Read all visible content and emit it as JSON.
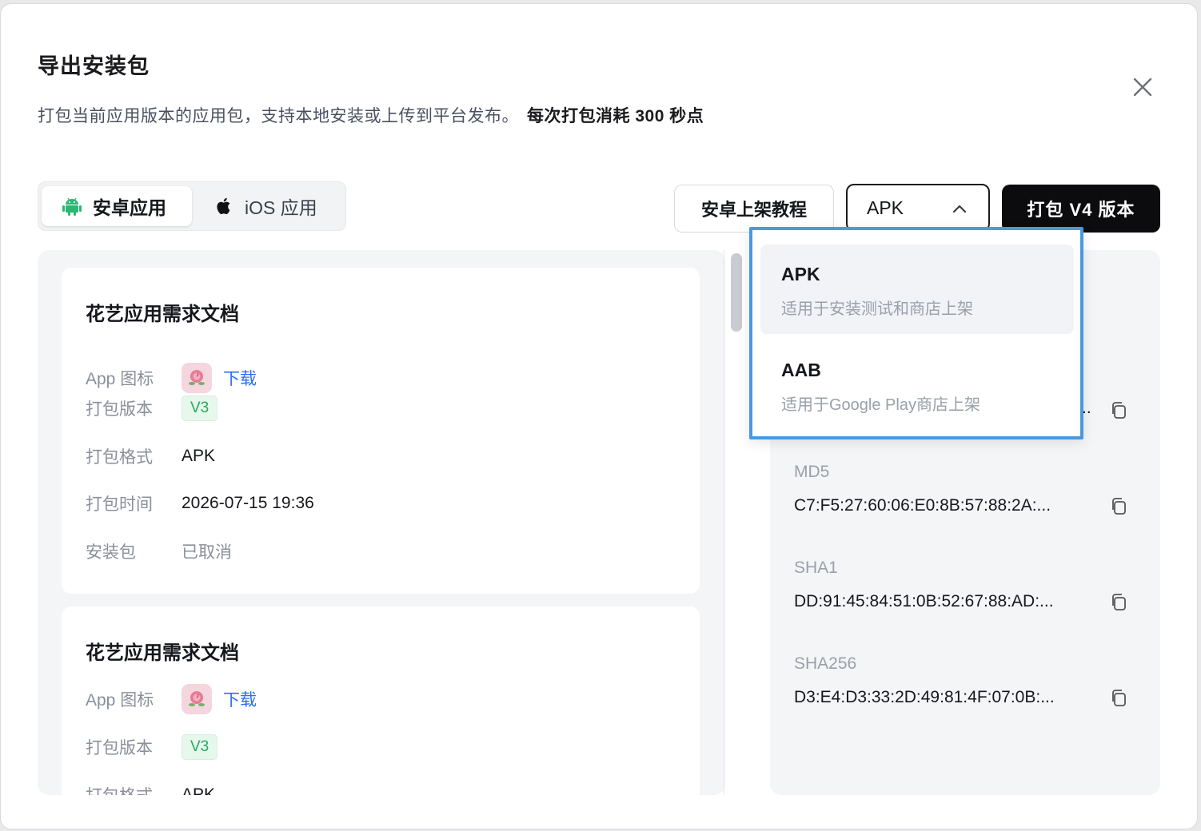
{
  "dialog": {
    "title": "导出安装包",
    "subtitle": "打包当前应用版本的应用包，支持本地安装或上传到平台发布。",
    "cost_note": "每次打包消耗 300 秒点"
  },
  "platform_tabs": [
    {
      "label": "安卓应用",
      "icon": "android-icon",
      "active": true
    },
    {
      "label": "iOS 应用",
      "icon": "apple-icon",
      "active": false
    }
  ],
  "toolbar": {
    "tutorial_label": "安卓上架教程",
    "format_selected": "APK",
    "build_label": "打包 V4 版本"
  },
  "format_options": [
    {
      "title": "APK",
      "desc": "适用于安装测试和商店上架"
    },
    {
      "title": "AAB",
      "desc": "适用于Google Play商店上架"
    }
  ],
  "builds": [
    {
      "title": "花艺应用需求文档",
      "icon_label": "App 图标",
      "download_label": "下载",
      "version_label": "打包版本",
      "version": "V3",
      "format_label": "打包格式",
      "format": "APK",
      "time_label": "打包时间",
      "time": "2026-07-15 19:36",
      "package_label": "安装包",
      "package_status": "已取消"
    },
    {
      "title": "花艺应用需求文档",
      "icon_label": "App 图标",
      "download_label": "下载",
      "version_label": "打包版本",
      "version": "V3",
      "format_label": "打包格式",
      "format": "APK"
    }
  ],
  "signature": {
    "partial_value": "..",
    "md5_label": "MD5",
    "md5": "C7:F5:27:60:06:E0:8B:57:88:2A:...",
    "sha1_label": "SHA1",
    "sha1": "DD:91:45:84:51:0B:52:67:88:AD:...",
    "sha256_label": "SHA256",
    "sha256": "D3:E4:D3:33:2D:49:81:4F:07:0B:..."
  },
  "colors": {
    "accent_link": "#2a6df4",
    "tag_green": "#2aa860",
    "primary_button": "#0c0c0f",
    "dropdown_highlight_border": "#4a98e0",
    "android_green": "#2bb673"
  }
}
